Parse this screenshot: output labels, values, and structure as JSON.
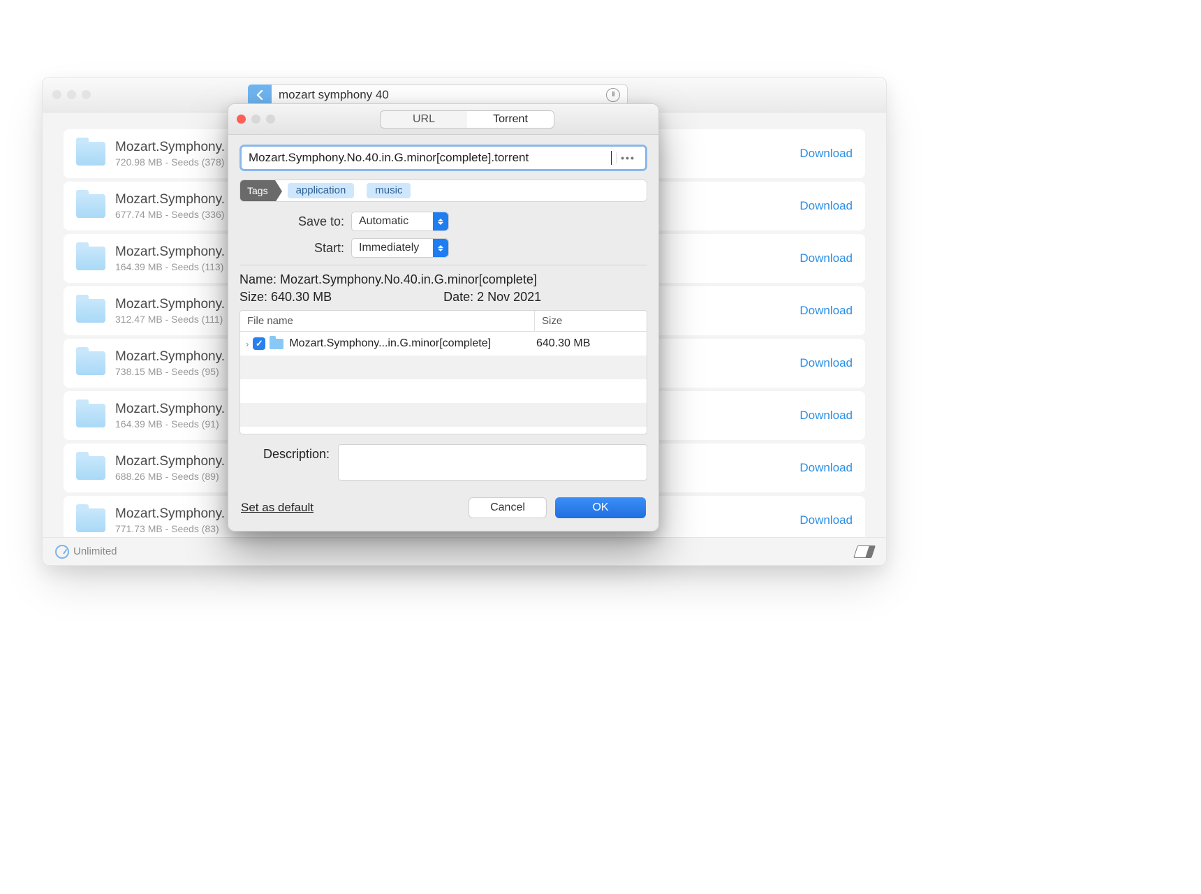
{
  "main": {
    "search_text": "mozart symphony 40",
    "footer_label": "Unlimited",
    "download_label": "Download",
    "results": [
      {
        "title": "Mozart.Symphony.",
        "sub": "720.98 MB - Seeds (378)"
      },
      {
        "title": "Mozart.Symphony.",
        "sub": "677.74 MB - Seeds (336)"
      },
      {
        "title": "Mozart.Symphony.",
        "sub": "164.39 MB - Seeds (113)"
      },
      {
        "title": "Mozart.Symphony.",
        "sub": "312.47 MB - Seeds (111)"
      },
      {
        "title": "Mozart.Symphony.",
        "sub": "738.15 MB - Seeds (95)"
      },
      {
        "title": "Mozart.Symphony.",
        "sub": "164.39 MB - Seeds (91)"
      },
      {
        "title": "Mozart.Symphony.",
        "sub": "688.26 MB - Seeds (89)"
      },
      {
        "title": "Mozart.Symphony.",
        "sub": "771.73 MB - Seeds (83)"
      }
    ]
  },
  "dialog": {
    "tabs": {
      "url": "URL",
      "torrent": "Torrent"
    },
    "file_input": "Mozart.Symphony.No.40.in.G.minor[complete].torrent",
    "tags_label": "Tags",
    "tag_chips": [
      "application",
      "music"
    ],
    "save_to": {
      "label": "Save to:",
      "value": "Automatic"
    },
    "start": {
      "label": "Start:",
      "value": "Immediately"
    },
    "name_line": "Name:  Mozart.Symphony.No.40.in.G.minor[complete]",
    "size_line": "Size:  640.30 MB",
    "date_line": "Date:  2 Nov 2021",
    "table": {
      "head_name": "File name",
      "head_size": "Size",
      "row_name": "Mozart.Symphony...in.G.minor[complete]",
      "row_size": "640.30 MB"
    },
    "description_label": "Description:",
    "set_default": "Set as default",
    "cancel": "Cancel",
    "ok": "OK"
  }
}
